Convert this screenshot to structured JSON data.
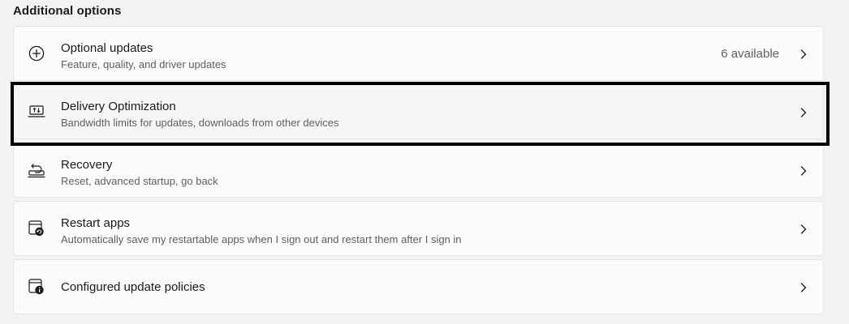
{
  "section": {
    "title": "Additional options"
  },
  "items": [
    {
      "title": "Optional updates",
      "subtitle": "Feature, quality, and driver updates",
      "trailing": "6 available",
      "icon": "plus-circle-icon"
    },
    {
      "title": "Delivery Optimization",
      "subtitle": "Bandwidth limits for updates, downloads from other devices",
      "icon": "delivery-optimization-icon",
      "focused": true
    },
    {
      "title": "Recovery",
      "subtitle": "Reset, advanced startup, go back",
      "icon": "recovery-icon"
    },
    {
      "title": "Restart apps",
      "subtitle": "Automatically save my restartable apps when I sign out and restart them after I sign in",
      "icon": "restart-apps-icon"
    },
    {
      "title": "Configured update policies",
      "icon": "update-policies-icon"
    }
  ],
  "colors": {
    "background": "#f3f3f3",
    "card": "#fbfbfb",
    "focus_ring": "#000000"
  }
}
